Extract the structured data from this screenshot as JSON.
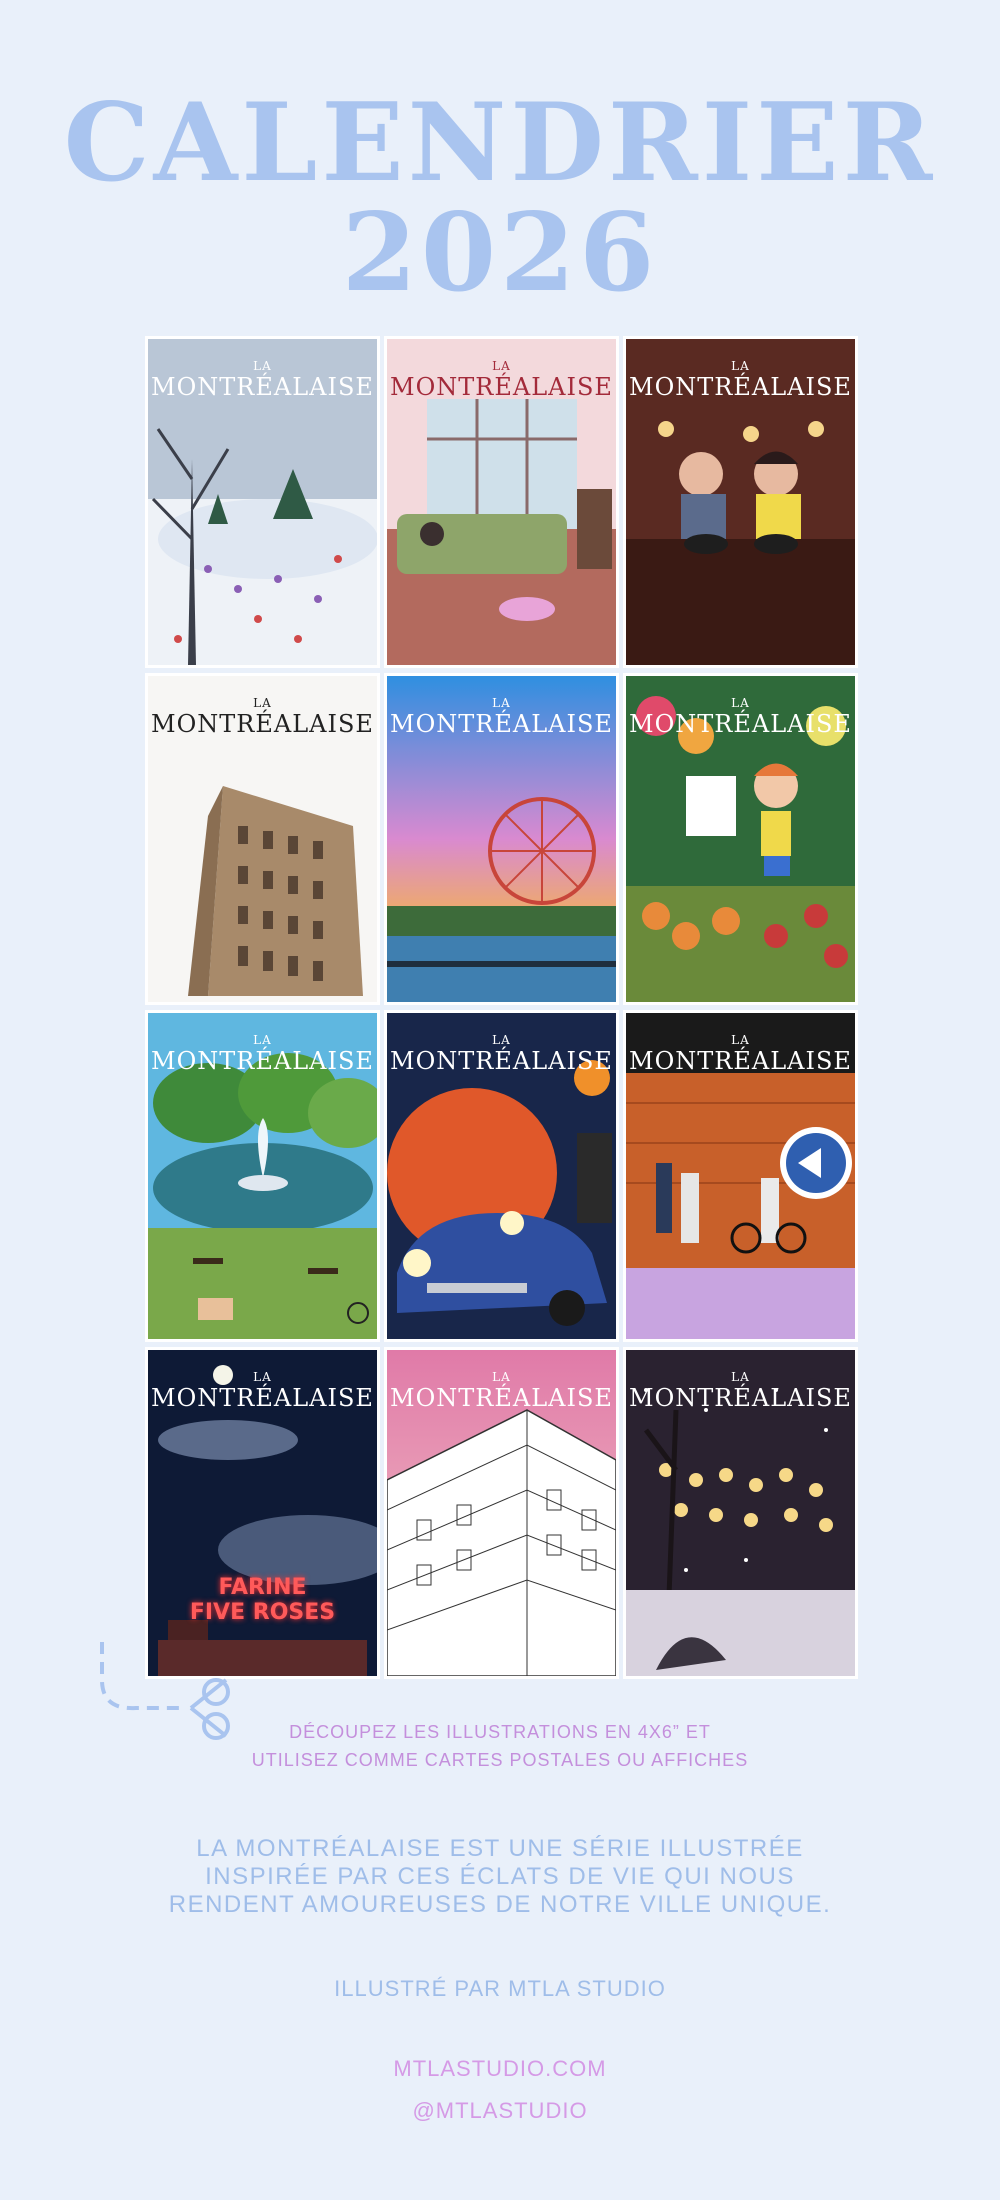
{
  "header": {
    "title_line1": "CALENDRIER",
    "title_line2": "2026"
  },
  "covers": [
    {
      "la": "LA",
      "name": "MONTRÉALAISE",
      "scene": "winter-skating-park"
    },
    {
      "la": "LA",
      "name": "MONTRÉALAISE",
      "scene": "reading-by-window"
    },
    {
      "la": "LA",
      "name": "MONTRÉALAISE",
      "scene": "ramen-bar"
    },
    {
      "la": "LA",
      "name": "MONTRÉALAISE",
      "scene": "flatiron-building"
    },
    {
      "la": "LA",
      "name": "MONTRÉALAISE",
      "scene": "ferris-wheel-sunset"
    },
    {
      "la": "LA",
      "name": "MONTRÉALAISE",
      "scene": "market-flowers"
    },
    {
      "la": "LA",
      "name": "MONTRÉALAISE",
      "scene": "park-fountain"
    },
    {
      "la": "LA",
      "name": "MONTRÉALAISE",
      "scene": "orange-julep-car"
    },
    {
      "la": "LA",
      "name": "MONTRÉALAISE",
      "scene": "metro-station"
    },
    {
      "la": "LA",
      "name": "MONTRÉALAISE",
      "scene": "farine-five-roses",
      "sign_line1": "FARINE",
      "sign_line2": "FIVE ROSES"
    },
    {
      "la": "LA",
      "name": "MONTRÉALAISE",
      "scene": "building-sketch"
    },
    {
      "la": "LA",
      "name": "MONTRÉALAISE",
      "scene": "snowy-street-lights"
    }
  ],
  "cut_note": {
    "line1": "DÉCOUPEZ LES ILLUSTRATIONS EN 4X6” ET",
    "line2": "UTILISEZ COMME CARTES POSTALES OU AFFICHES"
  },
  "about": {
    "line1": "LA MONTRÉALAISE EST UNE SÉRIE ILLUSTRÉE",
    "line2": "INSPIRÉE PAR CES ÉCLATS DE VIE QUI NOUS",
    "line3": "RENDENT AMOUREUSES DE NOTRE VILLE UNIQUE."
  },
  "credit": "ILLUSTRÉ PAR MTLA STUDIO",
  "website": "MTLASTUDIO.COM",
  "handle": "@MTLASTUDIO",
  "colors": {
    "background": "#e9f0fa",
    "title": "#a9c4ef",
    "accent_lavender": "#c48fdc",
    "text_blue": "#9fbde9",
    "link_pink": "#d59ae6"
  },
  "icons": {
    "scissors": "scissors-icon"
  }
}
